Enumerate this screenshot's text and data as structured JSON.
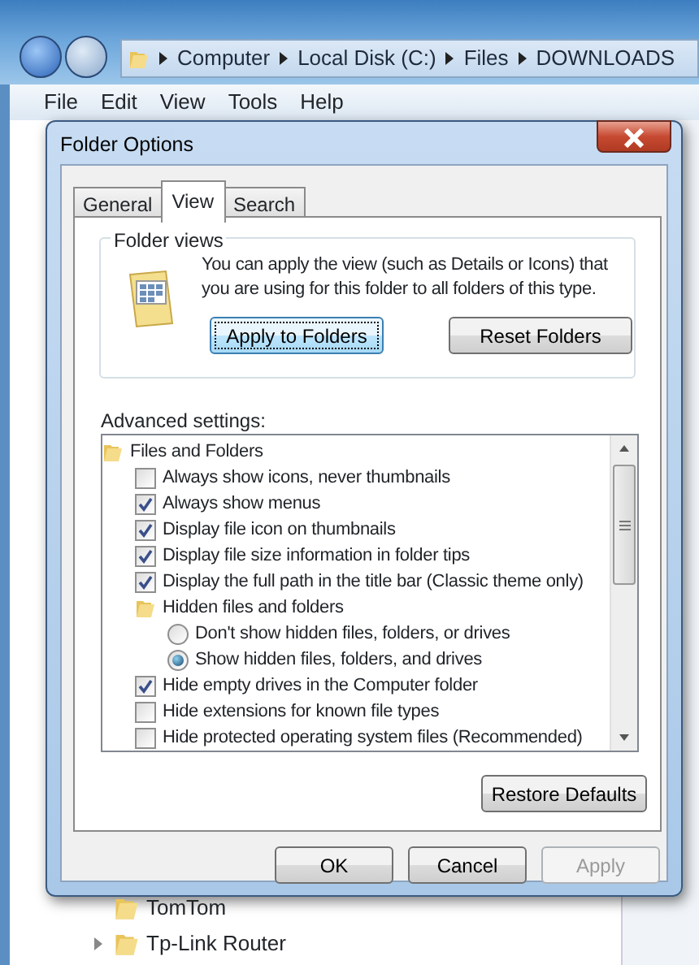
{
  "explorer": {
    "breadcrumb": [
      "Computer",
      "Local Disk (C:)",
      "Files",
      "DOWNLOADS"
    ],
    "menu": [
      "File",
      "Edit",
      "View",
      "Tools",
      "Help"
    ],
    "tree": [
      {
        "label": "TomTom",
        "expandable": false
      },
      {
        "label": "Tp-Link Router",
        "expandable": true
      }
    ]
  },
  "dialog": {
    "title": "Folder Options",
    "tabs": [
      {
        "label": "General",
        "selected": false
      },
      {
        "label": "View",
        "selected": true
      },
      {
        "label": "Search",
        "selected": false
      }
    ],
    "folder_views": {
      "legend": "Folder views",
      "text": "You can apply the view (such as Details or Icons) that you are using for this folder to all folders of this type.",
      "buttons": [
        {
          "label": "Apply to Folders",
          "focused": true
        },
        {
          "label": "Reset Folders",
          "focused": false
        }
      ]
    },
    "advanced_label": "Advanced settings:",
    "settings": [
      {
        "kind": "folder",
        "label": "Files and Folders",
        "children": [
          {
            "kind": "checkbox",
            "label": "Always show icons, never thumbnails",
            "checked": false
          },
          {
            "kind": "checkbox",
            "label": "Always show menus",
            "checked": true
          },
          {
            "kind": "checkbox",
            "label": "Display file icon on thumbnails",
            "checked": true
          },
          {
            "kind": "checkbox",
            "label": "Display file size information in folder tips",
            "checked": true
          },
          {
            "kind": "checkbox",
            "label": "Display the full path in the title bar (Classic theme only)",
            "checked": true
          },
          {
            "kind": "folder",
            "label": "Hidden files and folders",
            "children": [
              {
                "kind": "radio",
                "label": "Don't show hidden files, folders, or drives",
                "selected": false
              },
              {
                "kind": "radio",
                "label": "Show hidden files, folders, and drives",
                "selected": true
              }
            ]
          },
          {
            "kind": "checkbox",
            "label": "Hide empty drives in the Computer folder",
            "checked": true
          },
          {
            "kind": "checkbox",
            "label": "Hide extensions for known file types",
            "checked": false
          },
          {
            "kind": "checkbox",
            "label": "Hide protected operating system files (Recommended)",
            "checked": false
          }
        ]
      }
    ],
    "restore_button": "Restore Defaults",
    "buttons": [
      {
        "label": "OK",
        "disabled": false
      },
      {
        "label": "Cancel",
        "disabled": false
      },
      {
        "label": "Apply",
        "disabled": true
      }
    ]
  }
}
